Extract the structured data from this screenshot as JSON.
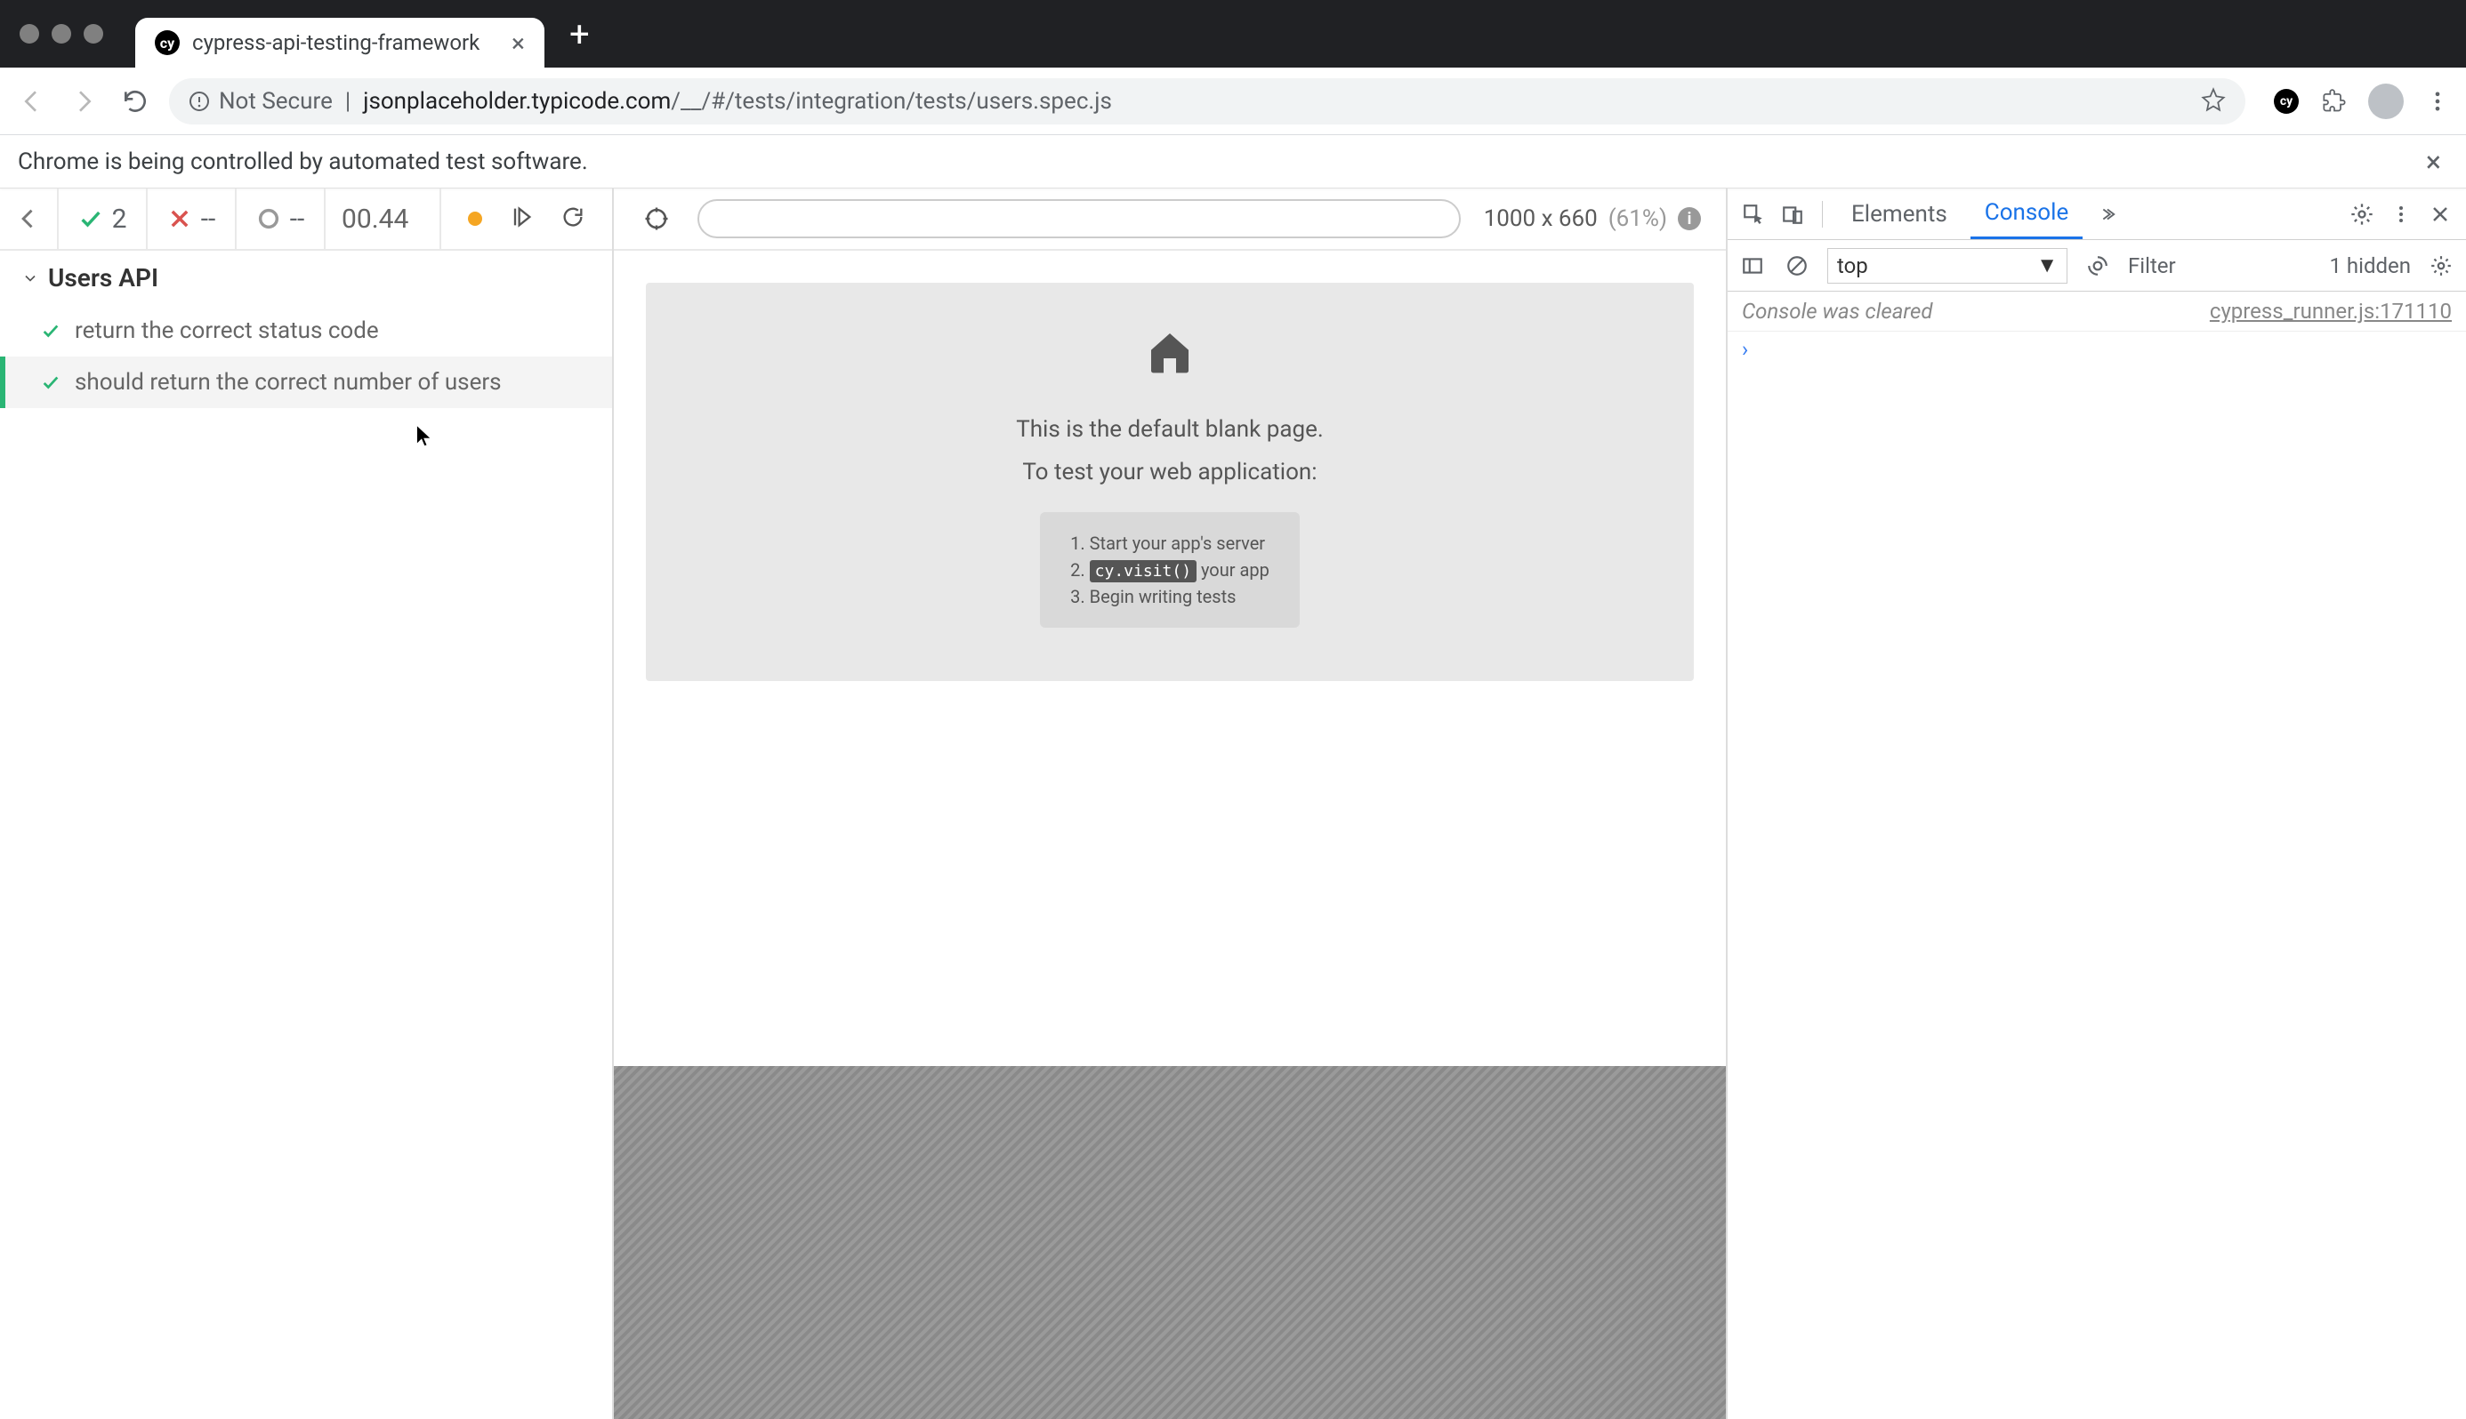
{
  "browser": {
    "tab_title": "cypress-api-testing-framework",
    "address": {
      "security_label": "Not Secure",
      "host": "jsonplaceholder.typicode.com",
      "path": "/__/#/tests/integration/tests/users.spec.js"
    }
  },
  "automation_bar": {
    "message": "Chrome is being controlled by automated test software."
  },
  "cypress": {
    "stats": {
      "passed": "2",
      "failed": "--",
      "pending": "--",
      "duration": "00.44"
    },
    "suite": {
      "name": "Users API",
      "tests": [
        {
          "title": "return the correct status code",
          "status": "passed"
        },
        {
          "title": "should return the correct number of users",
          "status": "passed"
        }
      ]
    },
    "viewport": {
      "dimensions": "1000 x 660",
      "scale": "(61%)"
    },
    "blank_page": {
      "title": "This is the default blank page.",
      "subtitle": "To test your web application:",
      "steps": {
        "s1": "Start your app's server",
        "s2_code": "cy.visit()",
        "s2_rest": " your app",
        "s3": "Begin writing tests"
      }
    }
  },
  "devtools": {
    "tabs": {
      "elements": "Elements",
      "console": "Console"
    },
    "context": "top",
    "filter_label": "Filter",
    "hidden": "1 hidden",
    "log": {
      "message": "Console was cleared",
      "source": "cypress_runner.js:171110"
    }
  }
}
